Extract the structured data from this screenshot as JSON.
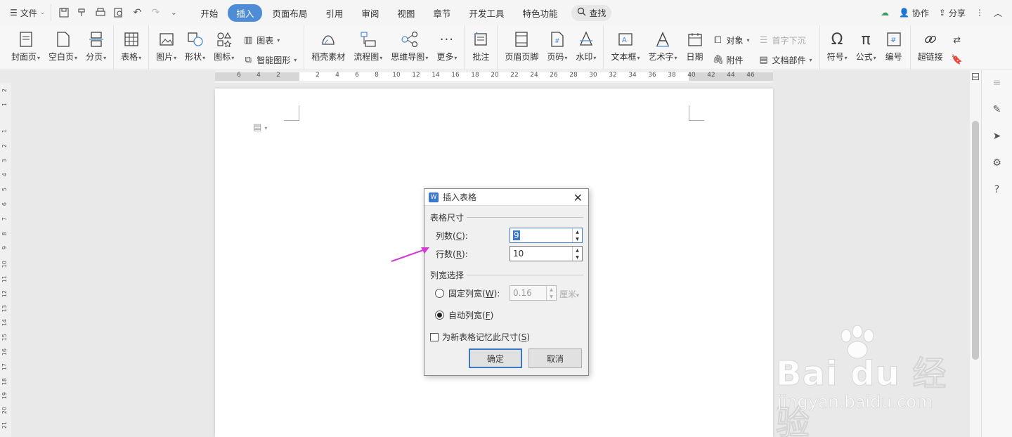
{
  "menubar": {
    "file_label": "文件",
    "tabs": [
      {
        "label": "开始",
        "active": false
      },
      {
        "label": "插入",
        "active": true
      },
      {
        "label": "页面布局",
        "active": false
      },
      {
        "label": "引用",
        "active": false
      },
      {
        "label": "审阅",
        "active": false
      },
      {
        "label": "视图",
        "active": false
      },
      {
        "label": "章节",
        "active": false
      },
      {
        "label": "开发工具",
        "active": false
      },
      {
        "label": "特色功能",
        "active": false
      }
    ],
    "search_label": "查找",
    "collab_label": "协作",
    "share_label": "分享"
  },
  "ribbon": {
    "cover": "封面页",
    "blank": "空白页",
    "pagebreak": "分页",
    "table": "表格",
    "picture": "图片",
    "shape": "形状",
    "icon": "图标",
    "chart": "图表",
    "smartart": "智能图形",
    "material": "稻壳素材",
    "flowchart": "流程图",
    "mindmap": "思维导图",
    "more": "更多",
    "comment": "批注",
    "header_footer": "页眉页脚",
    "page_number": "页码",
    "watermark": "水印",
    "textbox": "文本框",
    "wordart": "艺术字",
    "date": "日期",
    "object": "对象",
    "dropcap": "首字下沉",
    "attachment": "附件",
    "docpart": "文档部件",
    "symbol": "符号",
    "formula": "公式",
    "numbering": "编号",
    "hyperlink": "超链接"
  },
  "ruler": {
    "h_ticks": [
      "6",
      "4",
      "2",
      "",
      "2",
      "4",
      "6",
      "8",
      "10",
      "12",
      "14",
      "16",
      "18",
      "20",
      "22",
      "24",
      "26",
      "28",
      "30",
      "32",
      "34",
      "36",
      "38",
      "40",
      "42",
      "44",
      "46"
    ],
    "v_ticks_top": [
      "2",
      "1"
    ],
    "v_ticks": [
      "1",
      "2",
      "3",
      "4",
      "5",
      "6",
      "7",
      "8",
      "9",
      "10",
      "11",
      "12",
      "13",
      "14",
      "15",
      "16",
      "17",
      "18",
      "19",
      "20",
      "21"
    ]
  },
  "dialog": {
    "title": "插入表格",
    "size_section": "表格尺寸",
    "cols_label": "列数(",
    "cols_key": "C",
    "cols_suffix": "):",
    "cols_value": "9",
    "rows_label": "行数(",
    "rows_key": "R",
    "rows_suffix": "):",
    "rows_value": "10",
    "width_section": "列宽选择",
    "fixed_label": "固定列宽(",
    "fixed_key": "W",
    "fixed_suffix": "):",
    "fixed_value": "0.16",
    "unit": "厘米",
    "auto_label": "自动列宽(",
    "auto_key": "F",
    "auto_suffix": ")",
    "auto_selected": true,
    "remember_label": "为新表格记忆此尺寸(",
    "remember_key": "S",
    "remember_suffix": ")",
    "ok": "确定",
    "cancel": "取消"
  },
  "watermark": {
    "main": "Bai du 经验",
    "sub": "jingyan.baidu.com"
  },
  "colors": {
    "accent": "#4f8cd6",
    "arrow": "#d63ad6"
  }
}
